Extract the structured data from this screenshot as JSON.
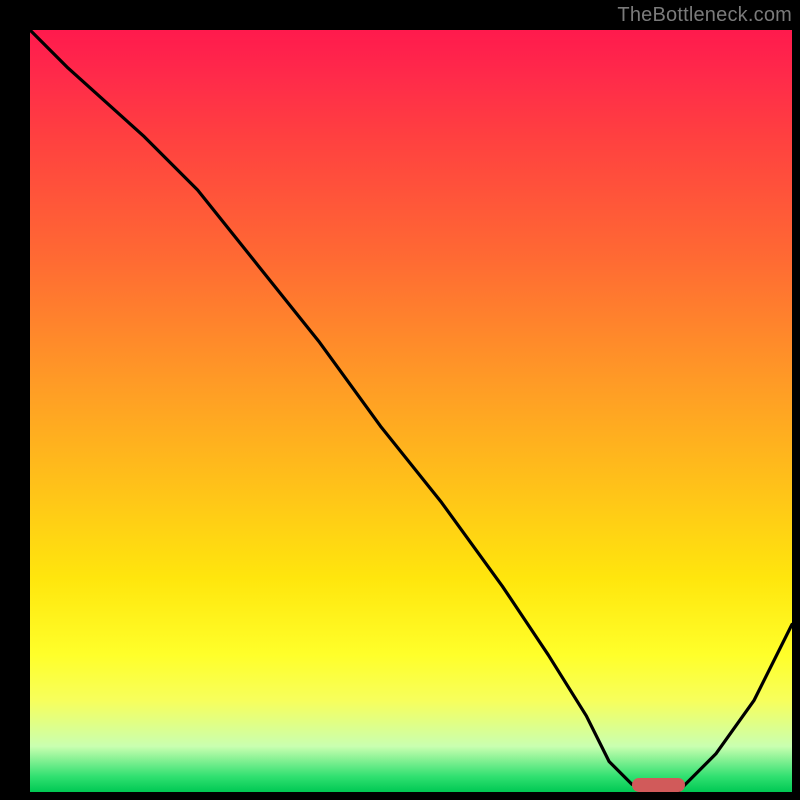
{
  "attribution": "TheBottleneck.com",
  "colors": {
    "gradient_top": "#ff1a4d",
    "gradient_mid": "#ffe60d",
    "gradient_bottom": "#00c853",
    "curve": "#000000",
    "marker": "#d15a5a",
    "frame": "#000000",
    "attribution_text": "#7a7a7a"
  },
  "chart_data": {
    "type": "line",
    "title": "",
    "xlabel": "",
    "ylabel": "",
    "xlim": [
      0,
      100
    ],
    "ylim": [
      0,
      100
    ],
    "grid": false,
    "legend": false,
    "series": [
      {
        "name": "bottleneck-curve",
        "x": [
          0,
          5,
          15,
          22,
          30,
          38,
          46,
          54,
          62,
          68,
          73,
          76,
          79,
          82,
          85,
          90,
          95,
          100
        ],
        "y": [
          100,
          95,
          86,
          79,
          69,
          59,
          48,
          38,
          27,
          18,
          10,
          4,
          1,
          0,
          0,
          5,
          12,
          22
        ]
      }
    ],
    "marker": {
      "x_start": 79,
      "x_end": 86,
      "y": 0
    },
    "annotations": []
  }
}
